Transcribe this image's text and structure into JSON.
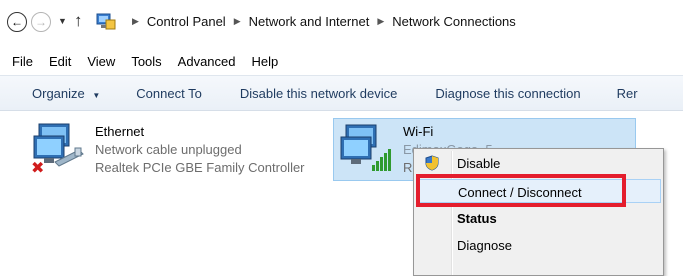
{
  "address": {
    "back_icon": "back-arrow-icon",
    "forward_icon": "forward-arrow-icon",
    "recent_icon": "chevron-down-icon",
    "up_icon": "up-arrow-icon",
    "crumbs": [
      "Control Panel",
      "Network and Internet",
      "Network Connections"
    ]
  },
  "menu": [
    "File",
    "Edit",
    "View",
    "Tools",
    "Advanced",
    "Help"
  ],
  "commands": {
    "organize": "Organize",
    "connect_to": "Connect To",
    "disable_device": "Disable this network device",
    "diagnose": "Diagnose this connection",
    "truncated": "Rer"
  },
  "adapters": {
    "ethernet": {
      "name": "Ethernet",
      "status": "Network cable unplugged",
      "device": "Realtek PCIe GBE Family Controller"
    },
    "wifi": {
      "name": "Wi-Fi",
      "status_partial": "EdimaxGogo_5",
      "device_partial": "Re"
    }
  },
  "context_menu": {
    "items": [
      "Disable",
      "Connect / Disconnect",
      "Status",
      "Diagnose"
    ]
  },
  "colors": {
    "selection": "#cce4f7",
    "highlight_box": "#e41d2d",
    "command_text": "#1e3a5f"
  }
}
